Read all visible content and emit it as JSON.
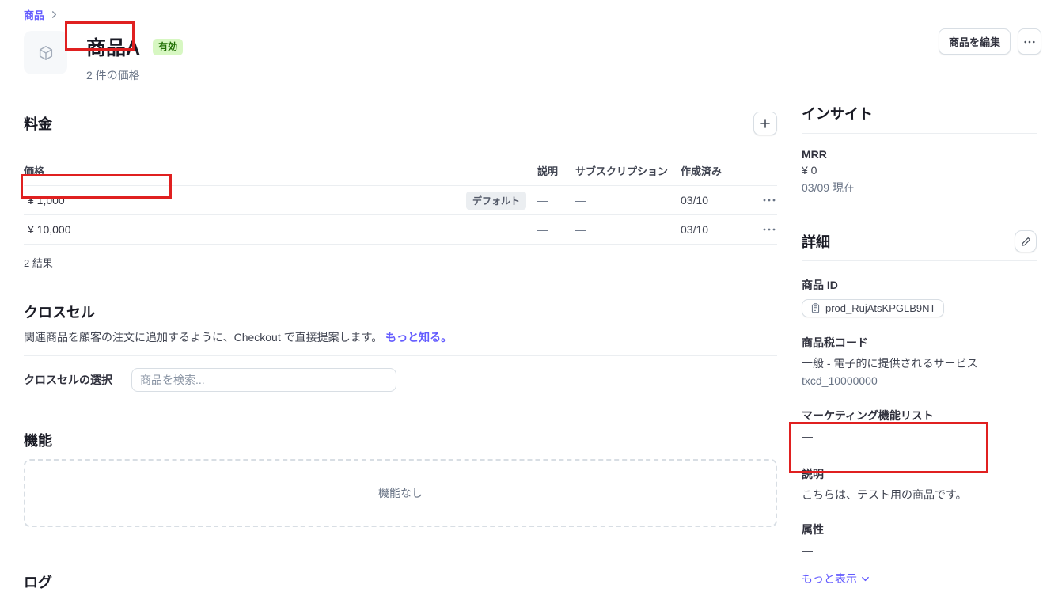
{
  "colors": {
    "accent_purple": "#635bff",
    "badge_green_bg": "#d7f7c2",
    "badge_green_text": "#217005",
    "annotation_red": "#e02020"
  },
  "breadcrumb": {
    "label": "商品"
  },
  "header": {
    "title": "商品A",
    "status_badge": "有効",
    "subtitle": "2 件の価格",
    "edit_button": "商品を編集"
  },
  "pricing": {
    "title": "料金",
    "table": {
      "columns": [
        "価格",
        "説明",
        "サブスクリプション",
        "作成済み"
      ],
      "rows": [
        {
          "price": "¥ 1,000",
          "badge": "デフォルト",
          "description": "—",
          "subscription": "—",
          "created": "03/10"
        },
        {
          "price": "¥ 10,000",
          "badge": "",
          "description": "—",
          "subscription": "—",
          "created": "03/10"
        }
      ]
    },
    "results_count": "2 結果"
  },
  "cross_sell": {
    "title": "クロスセル",
    "description": "関連商品を顧客の注文に追加するように、Checkout で直接提案します。",
    "learn_more": "もっと知る。",
    "select_label": "クロスセルの選択",
    "search_placeholder": "商品を検索..."
  },
  "features": {
    "title": "機能",
    "empty_text": "機能なし"
  },
  "logs": {
    "title": "ログ"
  },
  "insights": {
    "title": "インサイト",
    "mrr_label": "MRR",
    "mrr_value": "¥ 0",
    "mrr_date": "03/09 現在"
  },
  "details": {
    "title": "詳細",
    "product_id_label": "商品 ID",
    "product_id": "prod_RujAtsKPGLB9NT",
    "tax_code_label": "商品税コード",
    "tax_code_name": "一般 - 電子的に提供されるサービス",
    "tax_code": "txcd_10000000",
    "marketing_label": "マーケティング機能リスト",
    "marketing_value": "—",
    "description_label": "説明",
    "description_value": "こちらは、テスト用の商品です。",
    "attributes_label": "属性",
    "attributes_value": "—",
    "show_more": "もっと表示"
  }
}
